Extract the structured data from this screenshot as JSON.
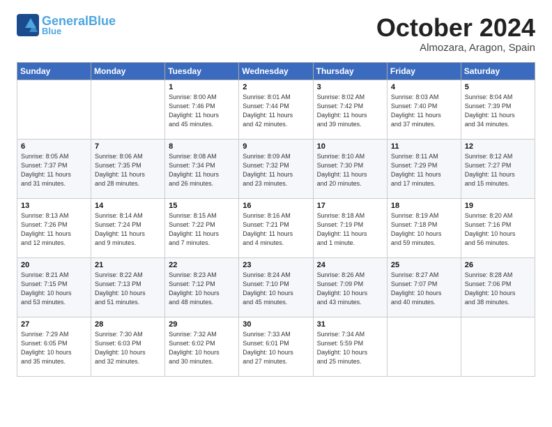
{
  "header": {
    "logo_general": "General",
    "logo_blue": "Blue",
    "month_title": "October 2024",
    "location": "Almozara, Aragon, Spain"
  },
  "weekdays": [
    "Sunday",
    "Monday",
    "Tuesday",
    "Wednesday",
    "Thursday",
    "Friday",
    "Saturday"
  ],
  "weeks": [
    [
      {
        "day": "",
        "info": ""
      },
      {
        "day": "",
        "info": ""
      },
      {
        "day": "1",
        "info": "Sunrise: 8:00 AM\nSunset: 7:46 PM\nDaylight: 11 hours\nand 45 minutes."
      },
      {
        "day": "2",
        "info": "Sunrise: 8:01 AM\nSunset: 7:44 PM\nDaylight: 11 hours\nand 42 minutes."
      },
      {
        "day": "3",
        "info": "Sunrise: 8:02 AM\nSunset: 7:42 PM\nDaylight: 11 hours\nand 39 minutes."
      },
      {
        "day": "4",
        "info": "Sunrise: 8:03 AM\nSunset: 7:40 PM\nDaylight: 11 hours\nand 37 minutes."
      },
      {
        "day": "5",
        "info": "Sunrise: 8:04 AM\nSunset: 7:39 PM\nDaylight: 11 hours\nand 34 minutes."
      }
    ],
    [
      {
        "day": "6",
        "info": "Sunrise: 8:05 AM\nSunset: 7:37 PM\nDaylight: 11 hours\nand 31 minutes."
      },
      {
        "day": "7",
        "info": "Sunrise: 8:06 AM\nSunset: 7:35 PM\nDaylight: 11 hours\nand 28 minutes."
      },
      {
        "day": "8",
        "info": "Sunrise: 8:08 AM\nSunset: 7:34 PM\nDaylight: 11 hours\nand 26 minutes."
      },
      {
        "day": "9",
        "info": "Sunrise: 8:09 AM\nSunset: 7:32 PM\nDaylight: 11 hours\nand 23 minutes."
      },
      {
        "day": "10",
        "info": "Sunrise: 8:10 AM\nSunset: 7:30 PM\nDaylight: 11 hours\nand 20 minutes."
      },
      {
        "day": "11",
        "info": "Sunrise: 8:11 AM\nSunset: 7:29 PM\nDaylight: 11 hours\nand 17 minutes."
      },
      {
        "day": "12",
        "info": "Sunrise: 8:12 AM\nSunset: 7:27 PM\nDaylight: 11 hours\nand 15 minutes."
      }
    ],
    [
      {
        "day": "13",
        "info": "Sunrise: 8:13 AM\nSunset: 7:26 PM\nDaylight: 11 hours\nand 12 minutes."
      },
      {
        "day": "14",
        "info": "Sunrise: 8:14 AM\nSunset: 7:24 PM\nDaylight: 11 hours\nand 9 minutes."
      },
      {
        "day": "15",
        "info": "Sunrise: 8:15 AM\nSunset: 7:22 PM\nDaylight: 11 hours\nand 7 minutes."
      },
      {
        "day": "16",
        "info": "Sunrise: 8:16 AM\nSunset: 7:21 PM\nDaylight: 11 hours\nand 4 minutes."
      },
      {
        "day": "17",
        "info": "Sunrise: 8:18 AM\nSunset: 7:19 PM\nDaylight: 11 hours\nand 1 minute."
      },
      {
        "day": "18",
        "info": "Sunrise: 8:19 AM\nSunset: 7:18 PM\nDaylight: 10 hours\nand 59 minutes."
      },
      {
        "day": "19",
        "info": "Sunrise: 8:20 AM\nSunset: 7:16 PM\nDaylight: 10 hours\nand 56 minutes."
      }
    ],
    [
      {
        "day": "20",
        "info": "Sunrise: 8:21 AM\nSunset: 7:15 PM\nDaylight: 10 hours\nand 53 minutes."
      },
      {
        "day": "21",
        "info": "Sunrise: 8:22 AM\nSunset: 7:13 PM\nDaylight: 10 hours\nand 51 minutes."
      },
      {
        "day": "22",
        "info": "Sunrise: 8:23 AM\nSunset: 7:12 PM\nDaylight: 10 hours\nand 48 minutes."
      },
      {
        "day": "23",
        "info": "Sunrise: 8:24 AM\nSunset: 7:10 PM\nDaylight: 10 hours\nand 45 minutes."
      },
      {
        "day": "24",
        "info": "Sunrise: 8:26 AM\nSunset: 7:09 PM\nDaylight: 10 hours\nand 43 minutes."
      },
      {
        "day": "25",
        "info": "Sunrise: 8:27 AM\nSunset: 7:07 PM\nDaylight: 10 hours\nand 40 minutes."
      },
      {
        "day": "26",
        "info": "Sunrise: 8:28 AM\nSunset: 7:06 PM\nDaylight: 10 hours\nand 38 minutes."
      }
    ],
    [
      {
        "day": "27",
        "info": "Sunrise: 7:29 AM\nSunset: 6:05 PM\nDaylight: 10 hours\nand 35 minutes."
      },
      {
        "day": "28",
        "info": "Sunrise: 7:30 AM\nSunset: 6:03 PM\nDaylight: 10 hours\nand 32 minutes."
      },
      {
        "day": "29",
        "info": "Sunrise: 7:32 AM\nSunset: 6:02 PM\nDaylight: 10 hours\nand 30 minutes."
      },
      {
        "day": "30",
        "info": "Sunrise: 7:33 AM\nSunset: 6:01 PM\nDaylight: 10 hours\nand 27 minutes."
      },
      {
        "day": "31",
        "info": "Sunrise: 7:34 AM\nSunset: 5:59 PM\nDaylight: 10 hours\nand 25 minutes."
      },
      {
        "day": "",
        "info": ""
      },
      {
        "day": "",
        "info": ""
      }
    ]
  ]
}
